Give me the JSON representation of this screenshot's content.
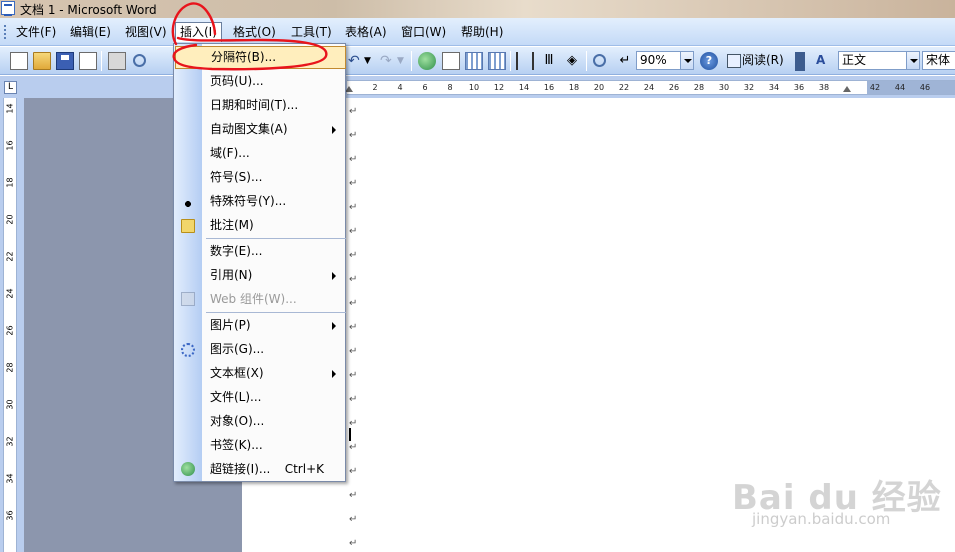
{
  "window": {
    "title": "文档 1 - Microsoft Word"
  },
  "menubar": {
    "items": [
      {
        "label": "文件(F)"
      },
      {
        "label": "编辑(E)"
      },
      {
        "label": "视图(V)"
      },
      {
        "label": "插入(I)"
      },
      {
        "label": "格式(O)"
      },
      {
        "label": "工具(T)"
      },
      {
        "label": "表格(A)"
      },
      {
        "label": "窗口(W)"
      },
      {
        "label": "帮助(H)"
      }
    ]
  },
  "toolbar": {
    "zoom": "90%",
    "read_label": "阅读(R)",
    "style": "正文",
    "font": "宋体"
  },
  "ruler": {
    "corner": "L",
    "ticks": [
      "2",
      "4",
      "6",
      "8",
      "10",
      "12",
      "14",
      "16",
      "18",
      "20",
      "22",
      "24",
      "26",
      "28",
      "30",
      "32",
      "34",
      "36",
      "38",
      "42",
      "44",
      "46"
    ],
    "vertical_ticks": [
      "14",
      "16",
      "18",
      "20",
      "22",
      "24",
      "26",
      "28",
      "30",
      "32",
      "34",
      "36"
    ]
  },
  "insert_menu": {
    "items": [
      {
        "label": "分隔符(B)..."
      },
      {
        "label": "页码(U)..."
      },
      {
        "label": "日期和时间(T)..."
      },
      {
        "label": "自动图文集(A)"
      },
      {
        "label": "域(F)..."
      },
      {
        "label": "符号(S)..."
      },
      {
        "label": "特殊符号(Y)..."
      },
      {
        "label": "批注(M)"
      },
      {
        "label": "数字(E)..."
      },
      {
        "label": "引用(N)"
      },
      {
        "label": "Web 组件(W)..."
      },
      {
        "label": "图片(P)"
      },
      {
        "label": "图示(G)..."
      },
      {
        "label": "文本框(X)"
      },
      {
        "label": "文件(L)..."
      },
      {
        "label": "对象(O)..."
      },
      {
        "label": "书签(K)..."
      },
      {
        "label": "超链接(I)...",
        "shortcut": "Ctrl+K"
      }
    ]
  },
  "watermark": {
    "logo": "Bai du 经验",
    "url": "jingyan.baidu.com"
  },
  "colors": {
    "annotation": "#e8141c",
    "menu_highlight": "#ffeebd",
    "menubar": "#c4daf7"
  }
}
